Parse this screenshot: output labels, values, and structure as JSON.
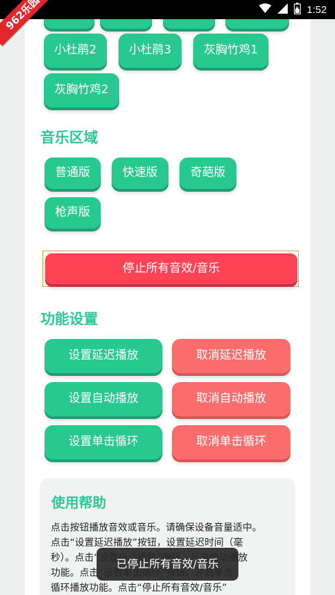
{
  "watermark": "962乐园",
  "status_bar": {
    "time": "1:52",
    "icons": [
      "wifi-icon",
      "signal-icon",
      "battery-icon"
    ]
  },
  "sound_buttons": {
    "top_partial": [
      "",
      "",
      "",
      ""
    ],
    "row1": [
      "小杜鹃2",
      "小杜鹃3",
      "灰胸竹鸡1"
    ],
    "row2": [
      "灰胸竹鸡2"
    ]
  },
  "music_section": {
    "title": "音乐区域",
    "buttons": [
      "普通版",
      "快速版",
      "奇葩版",
      "枪声版"
    ]
  },
  "stop_button": "停止所有音效/音乐",
  "function_section": {
    "title": "功能设置",
    "set_delay": "设置延迟播放",
    "cancel_delay": "取消延迟播放",
    "set_auto": "设置自动播放",
    "cancel_auto": "取消自动播放",
    "set_loop": "设置单击循环",
    "cancel_loop": "取消单击循环"
  },
  "help": {
    "title": "使用帮助",
    "lines": [
      "点击按钮播放音效或音乐。请确保设备音量适中。",
      "点击“设置延迟播放”按钮，设置延迟时间（毫",
      "秒）。点击“设置自动播放”按钮，开启自动播放",
      "功能。点击“设置单击循环”按钮，开启单击",
      "循环播放功能。点击“停止所有音效/音乐”"
    ]
  },
  "toast": "已停止所有音效/音乐",
  "colors": {
    "green": "#27c991",
    "red": "#fb6d6c",
    "stop_red": "#ff4356",
    "title_green": "#2cc896"
  }
}
